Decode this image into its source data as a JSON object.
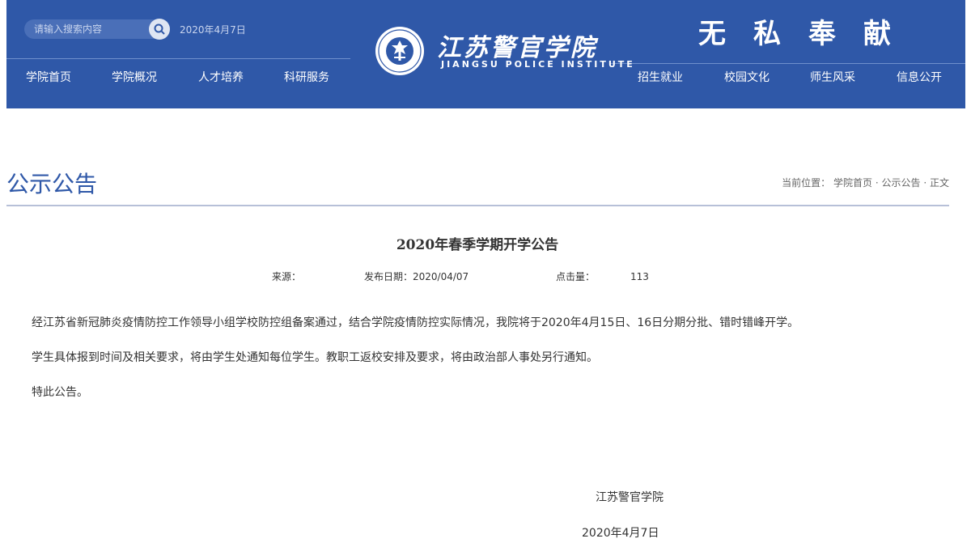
{
  "header": {
    "search": {
      "placeholder": "请输入搜索内容"
    },
    "date": "2020年4月7日",
    "nav_left": [
      "学院首页",
      "学院概况",
      "人才培养",
      "科研服务"
    ],
    "nav_right": [
      "招生就业",
      "校园文化",
      "师生风采",
      "信息公开"
    ],
    "logo_cn": "江苏警官学院",
    "logo_en": "JIANGSU POLICE INSTITUTE",
    "slogan": "无私奉献",
    "colors": {
      "header_bg": "#2f58a8",
      "nav_text": "#ffffff"
    }
  },
  "section": {
    "title": "公示公告",
    "breadcrumb": {
      "prefix": "当前位置：",
      "items": [
        "学院首页",
        "公示公告",
        "正文"
      ],
      "separator": "·"
    }
  },
  "article": {
    "title": "2020年春季学期开学公告",
    "meta": {
      "source_label": "来源：",
      "source_value": "",
      "date_label": "发布日期：2020/04/07",
      "hits_label": "点击量：",
      "hits_value": "113"
    },
    "paragraphs": [
      "经江苏省新冠肺炎疫情防控工作领导小组学校防控组备案通过，结合学院疫情防控实际情况，我院将于2020年4月15日、16日分期分批、错时错峰开学。",
      "学生具体报到时间及相关要求，将由学生处通知每位学生。教职工返校安排及要求，将由政治部人事处另行通知。",
      "特此公告。"
    ],
    "signature": "江苏警官学院",
    "sign_date": "2020年4月7日"
  }
}
